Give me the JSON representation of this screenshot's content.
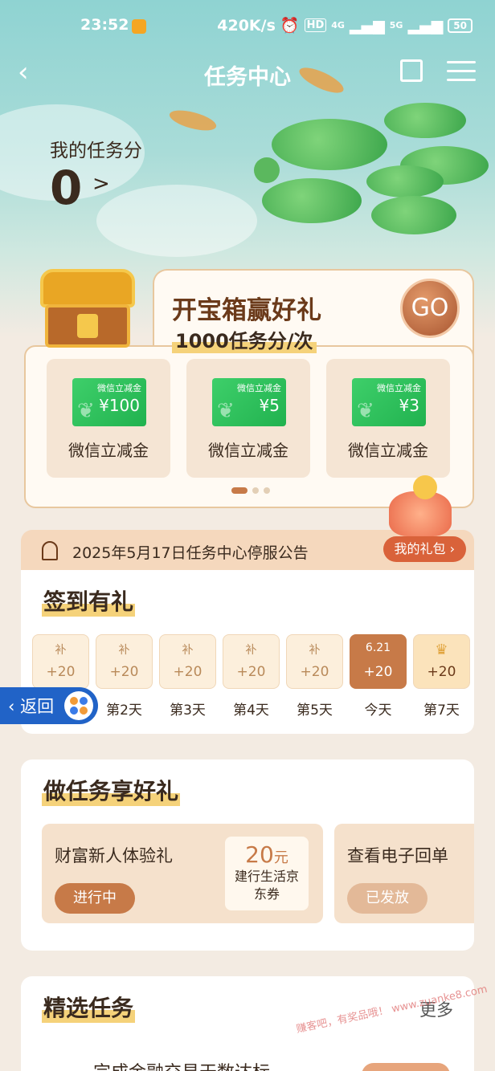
{
  "status_bar": {
    "time": "23:52",
    "speed": "420K/s",
    "hd": "HD",
    "net1": "4G",
    "net2": "5G",
    "battery": "50"
  },
  "nav": {
    "title": "任务中心"
  },
  "score": {
    "label": "我的任务分",
    "value": "0",
    "arrow": ">"
  },
  "chest": {
    "title": "开宝箱赢好礼",
    "subtitle": "1000任务分/次",
    "go": "GO",
    "coupons": [
      {
        "tag": "微信立减金",
        "amount": "¥100",
        "name": "微信立减金"
      },
      {
        "tag": "微信立减金",
        "amount": "¥5",
        "name": "微信立减金"
      },
      {
        "tag": "微信立减金",
        "amount": "¥3",
        "name": "微信立减金"
      }
    ]
  },
  "notice": {
    "text": "2025年5月17日任务中心停服公告",
    "gift_button": "我的礼包 ›"
  },
  "signin": {
    "title": "签到有礼",
    "days": [
      {
        "top": "补",
        "points": "+20",
        "label": ""
      },
      {
        "top": "补",
        "points": "+20",
        "label": "第2天"
      },
      {
        "top": "补",
        "points": "+20",
        "label": "第3天"
      },
      {
        "top": "补",
        "points": "+20",
        "label": "第4天"
      },
      {
        "top": "补",
        "points": "+20",
        "label": "第5天"
      },
      {
        "top": "6.21",
        "points": "+20",
        "label": "今天"
      },
      {
        "top": "♛",
        "points": "+20",
        "label": "第7天"
      }
    ]
  },
  "return_button": {
    "label": "‹ 返回"
  },
  "tasks": {
    "title": "做任务享好礼",
    "cards": [
      {
        "name": "财富新人体验礼",
        "button": "进行中",
        "reward_amount": "20",
        "reward_unit": "元",
        "reward_desc_1": "建行生活京",
        "reward_desc_2": "东券"
      },
      {
        "name": "查看电子回单",
        "button": "已发放"
      }
    ]
  },
  "featured": {
    "title": "精选任务",
    "more": "更多",
    "first_task": "完成金融交易天数达标"
  },
  "watermark": "赚客吧，有奖品哦！ www.zuanke8.com",
  "colors": {
    "accent": "#c77a48",
    "return_blue": "#2163c7",
    "wechat_green": "#21b24f"
  }
}
